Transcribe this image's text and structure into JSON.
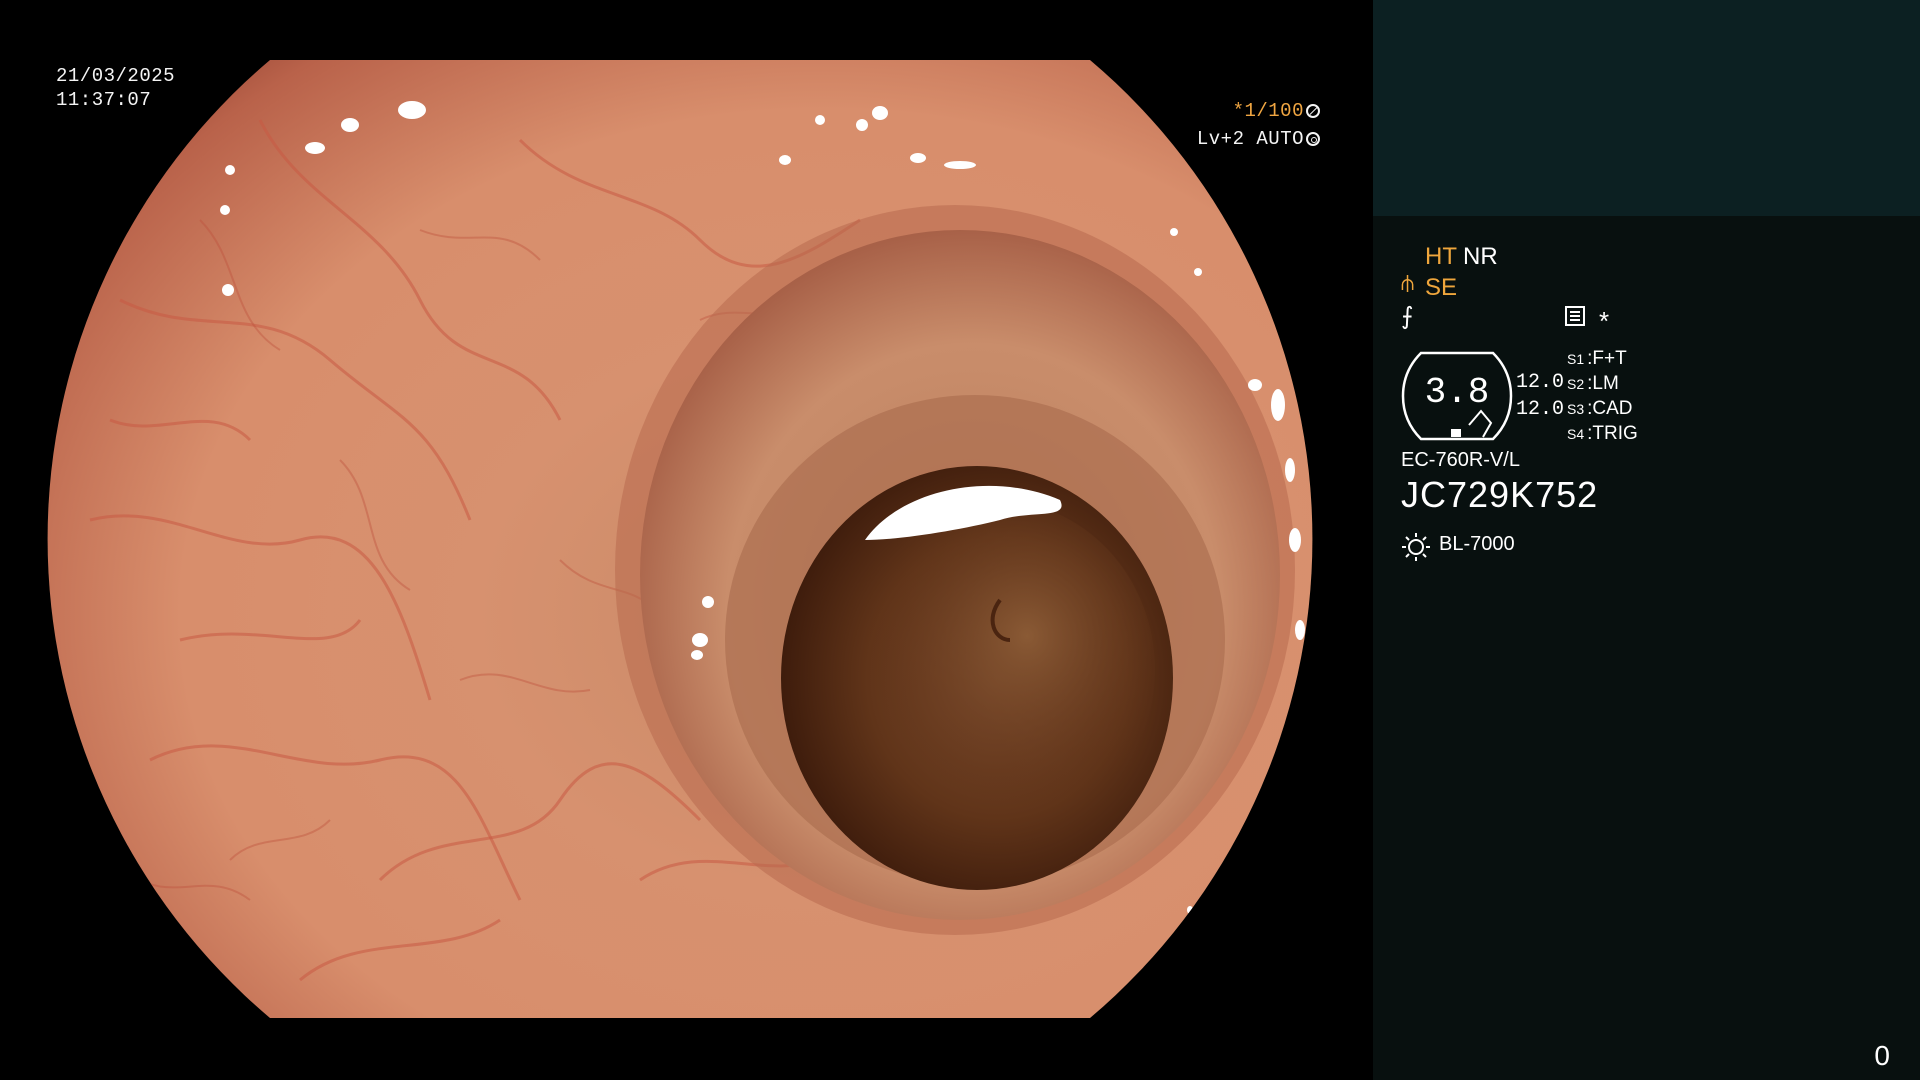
{
  "overlay": {
    "date": "21/03/2025",
    "time": "11:37:07",
    "shutter_prefix": "*1/100",
    "level": "Lv+2 AUTO"
  },
  "panel": {
    "ht": "HT",
    "nr": "NR",
    "se": "SE",
    "gauge_value": "3.8",
    "setting_values": [
      "12.0",
      "12.0"
    ],
    "switches": [
      {
        "key": "S1",
        "label": "F+T"
      },
      {
        "key": "S2",
        "label": "LM"
      },
      {
        "key": "S3",
        "label": "CAD"
      },
      {
        "key": "S4",
        "label": "TRIG"
      }
    ],
    "scope_model": "EC-760R-V/L",
    "serial": "JC729K752",
    "light_source": "BL-7000",
    "frame_counter": "0"
  },
  "colors": {
    "accent": "#efa63c",
    "panel_top": "#0c2022",
    "panel_bg": "#08100f"
  }
}
